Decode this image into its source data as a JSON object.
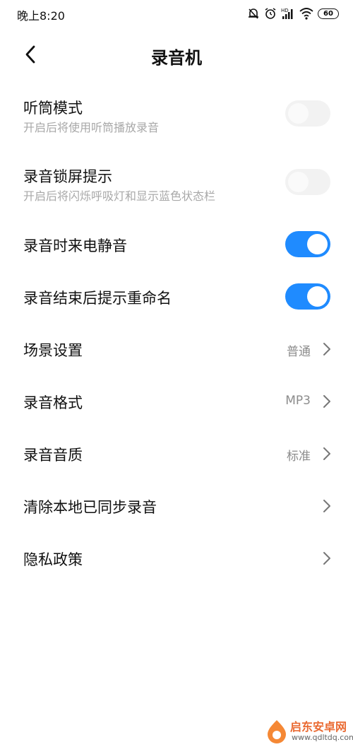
{
  "status_bar": {
    "time": "晚上8:20",
    "battery": "60",
    "icons": [
      "silent-bell-icon",
      "alarm-icon",
      "hd-signal-icon",
      "wifi-icon",
      "battery-icon"
    ]
  },
  "header": {
    "title": "录音机",
    "back_icon": "back-chevron-icon"
  },
  "settings": {
    "earpiece_mode": {
      "title": "听筒模式",
      "subtitle": "开启后将使用听筒播放录音",
      "enabled": false
    },
    "lockscreen_hint": {
      "title": "录音锁屏提示",
      "subtitle": "开启后将闪烁呼吸灯和显示蓝色状态栏",
      "enabled": false
    },
    "mute_calls": {
      "title": "录音时来电静音",
      "enabled": true
    },
    "rename_prompt": {
      "title": "录音结束后提示重命名",
      "enabled": true
    },
    "scene": {
      "title": "场景设置",
      "value": "普通"
    },
    "format": {
      "title": "录音格式",
      "value": "MP3"
    },
    "quality": {
      "title": "录音音质",
      "value": "标准"
    },
    "clear_synced": {
      "title": "清除本地已同步录音"
    },
    "privacy": {
      "title": "隐私政策"
    }
  },
  "colors": {
    "toggle_on": "#1f8bff",
    "toggle_off": "#f2f2f2",
    "subtitle": "#a8a8a8",
    "value": "#8c8c8c"
  },
  "watermark": {
    "name": "启东安卓网",
    "url": "www.qdltdq.com"
  }
}
